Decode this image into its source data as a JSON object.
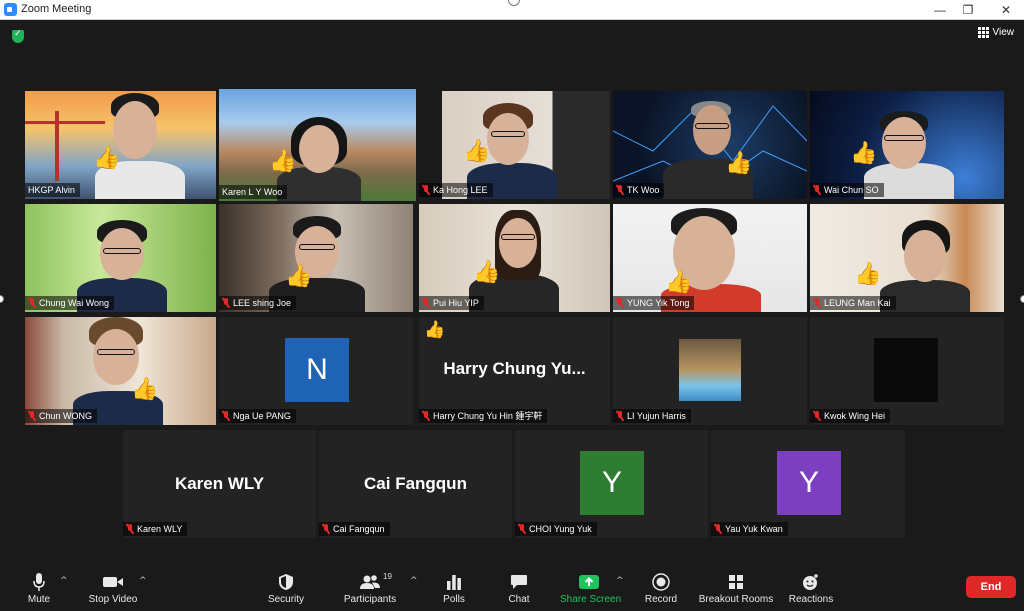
{
  "window": {
    "title": "Zoom Meeting",
    "view_label": "View",
    "controls": [
      "—",
      "❐",
      "✕"
    ]
  },
  "participants": [
    {
      "name": "HKGP Alvin",
      "muted": false
    },
    {
      "name": "Karen L Y Woo",
      "muted": false,
      "active_speaker": true
    },
    {
      "name": "Ka Hong LEE",
      "muted": true
    },
    {
      "name": "TK Woo",
      "muted": true
    },
    {
      "name": "Wai Chun SO",
      "muted": true
    },
    {
      "name": "Chung Wai Wong",
      "muted": true
    },
    {
      "name": "LEE shing Joe",
      "muted": true
    },
    {
      "name": "Pui Hiu YIP",
      "muted": true
    },
    {
      "name": "YUNG Yik Tong",
      "muted": true
    },
    {
      "name": "LEUNG Man Kai",
      "muted": true
    },
    {
      "name": "Chun WONG",
      "muted": true
    },
    {
      "name": "Nga Ue PANG",
      "muted": true,
      "avatar_letter": "N",
      "avatar_color": "#1f64b4"
    },
    {
      "name": "Harry Chung Yu Hin 鍾宇軒",
      "muted": true,
      "display": "Harry Chung Yu...",
      "reaction": "👍"
    },
    {
      "name": "LI Yujun Harris",
      "muted": true
    },
    {
      "name": "Kwok Wing Hei",
      "muted": true
    },
    {
      "name": "Karen WLY",
      "muted": true,
      "display": "Karen WLY"
    },
    {
      "name": "Cai Fangqun",
      "muted": true,
      "display": "Cai Fangqun"
    },
    {
      "name": "CHOI Yung Yuk",
      "muted": true,
      "avatar_letter": "Y",
      "avatar_color": "#2e7d32"
    },
    {
      "name": "Yau Yuk Kwan",
      "muted": true,
      "avatar_letter": "Y",
      "avatar_color": "#7b3fbf"
    }
  ],
  "toolbar": {
    "mute": "Mute",
    "stop_video": "Stop Video",
    "security": "Security",
    "participants": "Participants",
    "participants_count": "19",
    "polls": "Polls",
    "chat": "Chat",
    "share_screen": "Share Screen",
    "record": "Record",
    "breakout_rooms": "Breakout Rooms",
    "reactions": "Reactions",
    "end": "End"
  },
  "colors": {
    "active_speaker": "#e5e04d",
    "muted_mic": "#e02828",
    "share_screen": "#22c35e",
    "end_button": "#e02828"
  }
}
